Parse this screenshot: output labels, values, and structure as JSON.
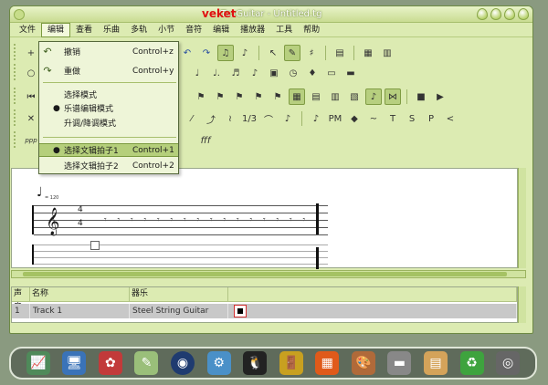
{
  "window": {
    "title": "TuxGuitar - Untitled.tg",
    "brand": "veket"
  },
  "menubar": [
    "文件",
    "编辑",
    "查看",
    "乐曲",
    "多轨",
    "小节",
    "音符",
    "编辑",
    "播放器",
    "工具",
    "帮助"
  ],
  "edit_menu": {
    "undo": {
      "label": "撤销",
      "shortcut": "Control+z"
    },
    "redo": {
      "label": "重做",
      "shortcut": "Control+y"
    },
    "select_mode": "选择模式",
    "edit_mode": "乐谱编辑模式",
    "transpose_mode": "升调/降调模式",
    "voice1": {
      "label": "选择文辑拍子1",
      "shortcut": "Control+1"
    },
    "voice2": {
      "label": "选择文辑拍子2",
      "shortcut": "Control+2"
    }
  },
  "toolbar_texts": {
    "fff": "fff",
    "ppp": "ppp",
    "fraction": "1/3",
    "pm": "PM",
    "t": "T",
    "s": "S",
    "p": "P"
  },
  "score": {
    "tempo": "= 120",
    "time_top": "4",
    "time_bottom": "4",
    "rest_glyph": "𝄾"
  },
  "track_table": {
    "headers": [
      "声音",
      "名称",
      "器乐",
      ""
    ],
    "rows": [
      {
        "num": "1",
        "name": "Track 1",
        "instrument": "Steel String Guitar"
      }
    ]
  },
  "colors": {
    "window_bg": "#dcebb2",
    "accent": "#7b9a3e",
    "brand": "#e01010"
  }
}
